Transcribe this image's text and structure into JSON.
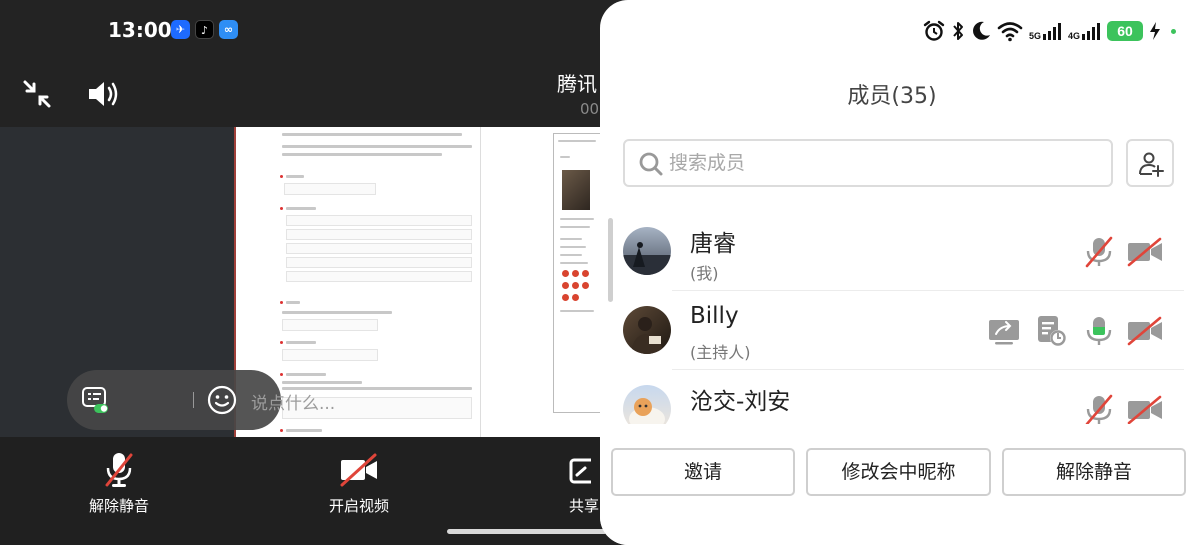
{
  "status_bar": {
    "time": "13:00",
    "app_icons": [
      "meeting-app-icon",
      "tiktok-icon",
      "cloud-app-icon"
    ],
    "network_1": "5G",
    "network_2": "4G",
    "battery": "60"
  },
  "meeting": {
    "title": "腾讯",
    "timer": "00"
  },
  "chat": {
    "placeholder": "说点什么..."
  },
  "toolbar": {
    "unmute_label": "解除静音",
    "video_label": "开启视频",
    "share_label": "共享"
  },
  "members_panel": {
    "title": "成员(35)",
    "search_placeholder": "搜索成员",
    "members": [
      {
        "name": "唐睿",
        "role": "(我)",
        "icons": [
          "mic-muted-icon",
          "camera-off-icon"
        ]
      },
      {
        "name": "Billy",
        "role": "(主持人)",
        "icons": [
          "screen-share-icon",
          "document-share-icon",
          "mic-active-icon",
          "camera-off-icon"
        ]
      },
      {
        "name": "沧交-刘安",
        "role": "",
        "icons": [
          "mic-muted-icon",
          "camera-off-icon"
        ]
      }
    ],
    "footer": {
      "invite": "邀请",
      "rename": "修改会中昵称",
      "unmute": "解除静音"
    }
  },
  "colors": {
    "accent_green": "#3cc35c",
    "muted_red": "#e0453a",
    "panel_bg": "#ffffff",
    "dark_bg": "#232323"
  }
}
